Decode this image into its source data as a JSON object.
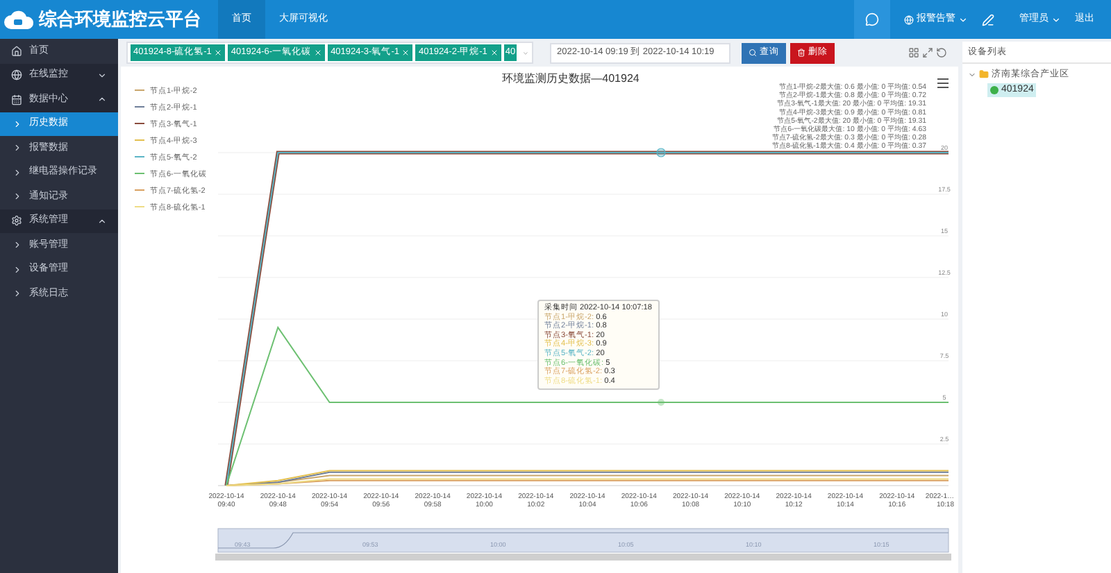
{
  "header": {
    "title": "综合环境监控云平台",
    "nav": [
      {
        "label": "首页",
        "selected": true
      },
      {
        "label": "大屏可视化",
        "selected": false
      }
    ],
    "alarm": "报警告警",
    "user": "管理员",
    "logout": "退出"
  },
  "sidebar": {
    "items": [
      {
        "label": "首页",
        "kind": "link",
        "selected": false
      },
      {
        "label": "在线监控",
        "kind": "group",
        "selected": false,
        "expanded": false
      },
      {
        "label": "数据中心",
        "kind": "group",
        "selected": false,
        "expanded": true,
        "children": [
          {
            "label": "历史数据",
            "selected": true
          },
          {
            "label": "报警数据",
            "selected": false
          },
          {
            "label": "继电器操作记录",
            "selected": false
          },
          {
            "label": "通知记录",
            "selected": false
          }
        ]
      },
      {
        "label": "系统管理",
        "kind": "group",
        "selected": false,
        "expanded": true,
        "children": [
          {
            "label": "账号管理",
            "selected": false
          },
          {
            "label": "设备管理",
            "selected": false
          },
          {
            "label": "系统日志",
            "selected": false
          }
        ]
      }
    ]
  },
  "toolbar": {
    "tags": [
      {
        "label": "401924-8-硫化氢-1",
        "kind": "tag"
      },
      {
        "label": "401924-6-一氧化碳",
        "kind": "tag"
      },
      {
        "label": "401924-3-氧气-1",
        "kind": "tag"
      },
      {
        "label": "401924-2-甲烷-1",
        "kind": "tag"
      },
      {
        "label": "40",
        "kind": "overflow"
      }
    ],
    "date_range": "2022-10-14 09:19 到 2022-10-14 10:19",
    "buttons": [
      {
        "label": "查询",
        "kind": "search"
      },
      {
        "label": "删除",
        "kind": "delete"
      }
    ]
  },
  "chart": {
    "title": "环境监测历史数据—401924",
    "stats": [
      "节点1-甲烷-2最大值: 0.6 最小值: 0 平均值: 0.54",
      "节点2-甲烷-1最大值: 0.8 最小值: 0 平均值: 0.72",
      "节点3-氧气-1最大值: 20 最小值: 0 平均值: 19.31",
      "节点4-甲烷-3最大值: 0.9 最小值: 0 平均值: 0.81",
      "节点5-氧气-2最大值: 20 最小值: 0 平均值: 19.31",
      "节点6-一氧化碳最大值: 10 最小值: 0 平均值: 4.63",
      "节点7-硫化氢-2最大值: 0.3 最小值: 0 平均值: 0.28",
      "节点8-硫化氢-1最大值: 0.4 最小值: 0 平均值: 0.37"
    ],
    "tooltip": {
      "title": "采集时间 2022-10-14 10:07:18",
      "items": [
        {
          "label": "节点1-甲烷-2:",
          "value": "0.6"
        },
        {
          "label": "节点2-甲烷-1:",
          "value": "0.8"
        },
        {
          "label": "节点3-氧气-1:",
          "value": "20"
        },
        {
          "label": "节点4-甲烷-3:",
          "value": "0.9"
        },
        {
          "label": "节点5-氧气-2:",
          "value": "20"
        },
        {
          "label": "节点6-一氧化碳:",
          "value": "5"
        },
        {
          "label": "节点7-硫化氢-2:",
          "value": "0.3"
        },
        {
          "label": "节点8-硫化氢-1:",
          "value": "0.4"
        }
      ]
    },
    "zoom_labels": [
      "09:43",
      "09:53",
      "10:00",
      "10:05",
      "10:10",
      "10:15"
    ],
    "chart_data": {
      "type": "line",
      "grid": true,
      "legend": "left",
      "ylim": [
        0,
        20
      ],
      "x": [
        "2022-10-14 09:40",
        "2022-10-14 09:48",
        "2022-10-14 09:54",
        "2022-10-14 09:56",
        "2022-10-14 09:58",
        "2022-10-14 10:00",
        "2022-10-14 10:02",
        "2022-10-14 10:04",
        "2022-10-14 10:06",
        "2022-10-14 10:08",
        "2022-10-14 10:10",
        "2022-10-14 10:12",
        "2022-10-14 10:14",
        "2022-10-14 10:16",
        "2022-1… 10:18"
      ],
      "yticks": [
        2.5,
        5,
        7.5,
        10,
        12.5,
        15,
        17.5,
        20
      ],
      "series": [
        {
          "name": "节点1-甲烷-2",
          "color": "#c9a66b",
          "values": [
            0,
            0.2,
            0.6,
            0.6,
            0.6,
            0.6,
            0.6,
            0.6,
            0.6,
            0.6,
            0.6,
            0.6,
            0.6,
            0.6,
            0.6
          ]
        },
        {
          "name": "节点2-甲烷-1",
          "color": "#6f7f99",
          "values": [
            0,
            0.2,
            0.8,
            0.8,
            0.8,
            0.8,
            0.8,
            0.8,
            0.8,
            0.8,
            0.8,
            0.8,
            0.8,
            0.8,
            0.8
          ]
        },
        {
          "name": "节点3-氧气-1",
          "color": "#8a4b3c",
          "values": [
            0,
            20,
            20,
            20,
            20,
            20,
            20,
            20,
            20,
            20,
            20,
            20,
            20,
            20,
            20
          ]
        },
        {
          "name": "节点4-甲烷-3",
          "color": "#e3c04f",
          "values": [
            0,
            0.3,
            0.9,
            0.9,
            0.9,
            0.9,
            0.9,
            0.9,
            0.9,
            0.9,
            0.9,
            0.9,
            0.9,
            0.9,
            0.9
          ]
        },
        {
          "name": "节点5-氧气-2",
          "color": "#5bb5c6",
          "values": [
            0,
            20,
            20,
            20,
            20,
            20,
            20,
            20,
            20,
            20,
            20,
            20,
            20,
            20,
            20
          ]
        },
        {
          "name": "节点6-一氧化碳",
          "color": "#6cc071",
          "values": [
            0,
            9.5,
            5,
            5,
            5,
            5,
            5,
            5,
            5,
            5,
            5,
            5,
            5,
            5,
            5
          ]
        },
        {
          "name": "节点7-硫化氢-2",
          "color": "#d9a060",
          "values": [
            0,
            0.1,
            0.3,
            0.3,
            0.3,
            0.3,
            0.3,
            0.3,
            0.3,
            0.3,
            0.3,
            0.3,
            0.3,
            0.3,
            0.3
          ]
        },
        {
          "name": "节点8-硫化氢-1",
          "color": "#efdc86",
          "values": [
            0,
            0.1,
            0.4,
            0.4,
            0.4,
            0.4,
            0.4,
            0.4,
            0.4,
            0.4,
            0.4,
            0.4,
            0.4,
            0.4,
            0.4
          ]
        }
      ]
    }
  },
  "devices": {
    "title": "设备列表",
    "tree": [
      {
        "label": "济南某综合产业区",
        "expanded": true,
        "children": [
          {
            "label": "401924",
            "selected": true
          }
        ]
      }
    ]
  }
}
